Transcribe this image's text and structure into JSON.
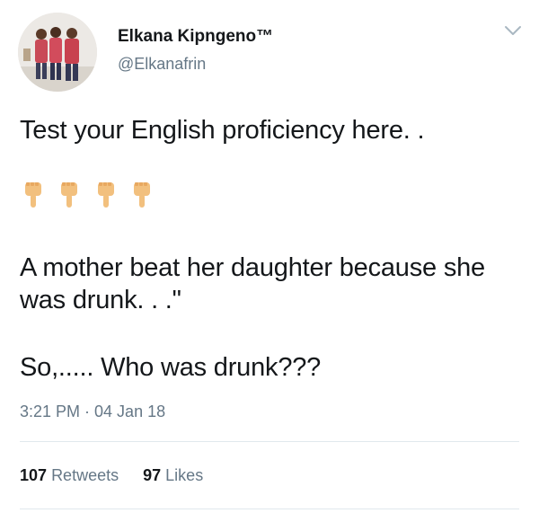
{
  "user": {
    "name": "Elkana Kipngeno™",
    "handle": "@Elkanafrin"
  },
  "tweet": {
    "line1": "Test your English proficiency here. .",
    "emojis": [
      "finger-pointing-down-icon",
      "finger-pointing-down-icon",
      "finger-pointing-down-icon",
      "finger-pointing-down-icon"
    ],
    "line2": "A mother beat her daughter because she",
    "line3": "was drunk. . .\"",
    "line4": "So,..... Who was drunk???",
    "timestamp": "3:21 PM · 04 Jan 18"
  },
  "stats": {
    "retweets_count": "107",
    "retweets_label": "Retweets",
    "likes_count": "97",
    "likes_label": "Likes"
  },
  "colors": {
    "text": "#14171a",
    "muted": "#657786",
    "divider": "#e1e8ed",
    "emoji_skin": "#f2c07e"
  }
}
